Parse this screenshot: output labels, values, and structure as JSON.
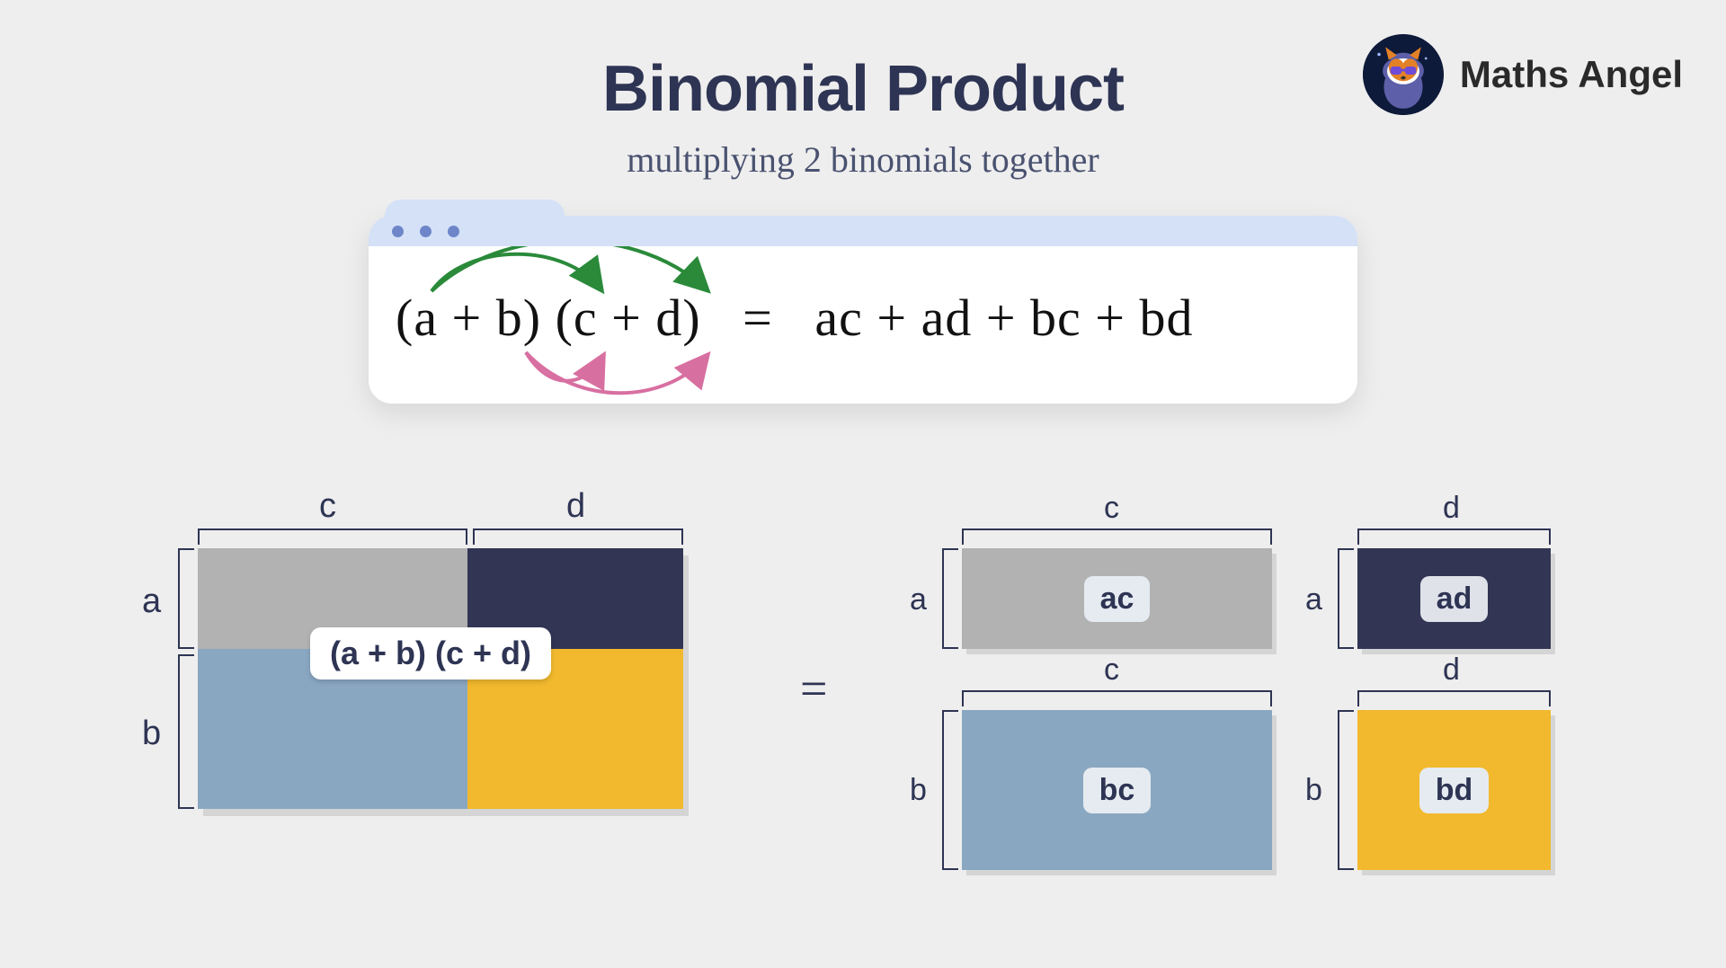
{
  "brand": {
    "name": "Maths Angel"
  },
  "title": "Binomial Product",
  "subtitle": "multiplying 2 binomials together",
  "formula": {
    "lhs": "(a + b) (c + d)",
    "eq": "=",
    "rhs": "ac + ad + bc + bd"
  },
  "diagram": {
    "combined_label": "(a + b) (c + d)",
    "equals": "=",
    "vars": {
      "a": "a",
      "b": "b",
      "c": "c",
      "d": "d"
    },
    "cells": {
      "ac": "ac",
      "ad": "ad",
      "bc": "bc",
      "bd": "bd"
    }
  },
  "colors": {
    "ac": "#b2b2b2",
    "ad": "#323654",
    "bc": "#8aa7c2",
    "bd": "#f2b92e",
    "arrow_top": "#2a8a3a",
    "arrow_bottom": "#d86fa1"
  }
}
